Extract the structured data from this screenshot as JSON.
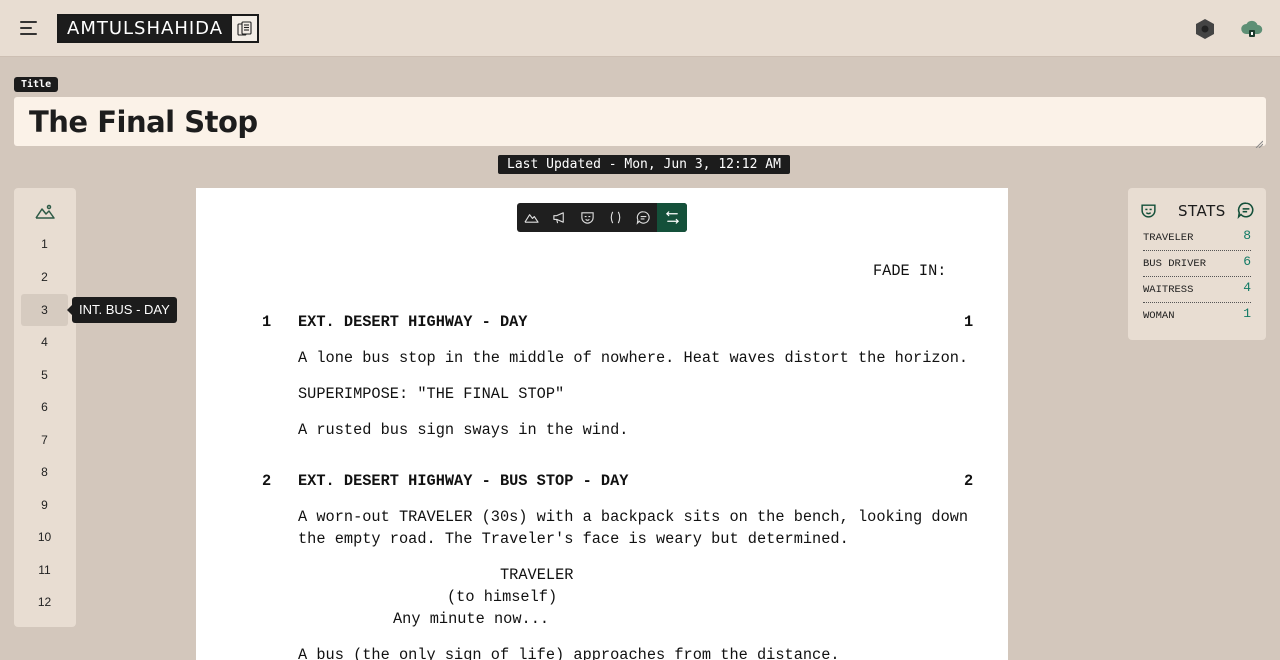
{
  "header": {
    "brand": "AMTULSHAHIDA",
    "icons": [
      "menu-icon",
      "script-copy-icon",
      "hexagon-settings-icon",
      "cloud-sync-icon"
    ]
  },
  "title": {
    "tag": "Title",
    "value": "The Final Stop"
  },
  "last_updated": "Last Updated - Mon, Jun 3, 12:12 AM",
  "scenes": {
    "icon": "mountains-icon",
    "items": [
      "1",
      "2",
      "3",
      "4",
      "5",
      "6",
      "7",
      "8",
      "9",
      "10",
      "11",
      "12"
    ],
    "active_index": 2,
    "tooltip": "INT. BUS - DAY"
  },
  "toolbar": {
    "tools": [
      "scene-heading",
      "action",
      "character",
      "parenthetical",
      "dialogue",
      "transition"
    ],
    "active": "transition"
  },
  "script": {
    "fade_in": "FADE IN:",
    "scene1": {
      "number": "1",
      "heading": "EXT. DESERT HIGHWAY - DAY",
      "lines": [
        "A lone bus stop in the middle of nowhere. Heat waves distort the horizon.",
        "SUPERIMPOSE: \"THE FINAL STOP\"",
        "A rusted bus sign sways in the wind."
      ]
    },
    "scene2": {
      "number": "2",
      "heading": "EXT. DESERT HIGHWAY - BUS STOP - DAY",
      "action1": "A worn-out TRAVELER (30s) with a backpack sits on the bench, looking down",
      "action2": "the empty road. The Traveler's face is weary but determined.",
      "character": "TRAVELER",
      "parenthetical": "(to himself)",
      "dialogue": "Any minute now...",
      "action3": "A bus (the only sign of life) approaches from the distance."
    }
  },
  "stats": {
    "title": "STATS",
    "rows": [
      {
        "name": "TRAVELER",
        "count": "8"
      },
      {
        "name": "BUS DRIVER",
        "count": "6"
      },
      {
        "name": "WAITRESS",
        "count": "4"
      },
      {
        "name": "WOMAN",
        "count": "1"
      }
    ]
  },
  "colors": {
    "accent": "#14503a",
    "background": "#d3c7bc",
    "panel": "#e8ddd2",
    "stat_count": "#117a65"
  }
}
